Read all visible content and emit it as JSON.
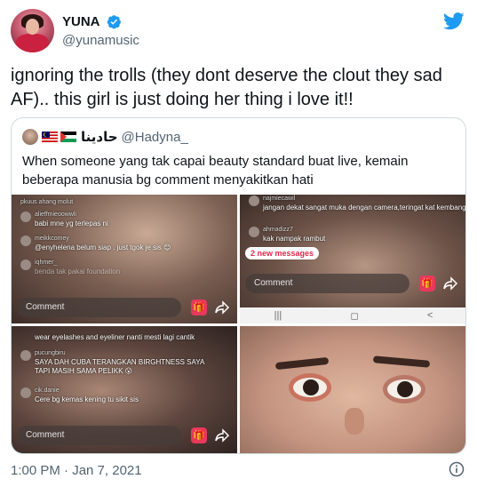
{
  "author": {
    "name": "YUNA",
    "handle": "@yunamusic",
    "verified": true
  },
  "tweet": {
    "text": "ignoring the trolls (they dont deserve the clout they sad AF).. this girl is just doing her thing i love it!!"
  },
  "quoted": {
    "name": "حادينا",
    "handle": "@Hadyna_",
    "text": "When someone yang tak capai beauty standard buat live, kemain beberapa manusia bg comment menyakitkan hati",
    "images": [
      {
        "comments": [
          {
            "user": "pkuus ahang molut",
            "text": ""
          },
          {
            "user": "alieffmieoowwli",
            "text": "babi mne yg terlepas ni"
          },
          {
            "user": "meikkcomey",
            "text": "@enyhelena belum siap . just tgok je sis 😊"
          },
          {
            "user": "iqhmer_",
            "text": "benda tak pakai foundation"
          }
        ],
        "input_placeholder": "Comment"
      },
      {
        "comments": [
          {
            "user": "najmiecawil",
            "text": "jangan dekat sangat muka dengan camera,teringat kat kembang"
          },
          {
            "user": "ahmadizz7",
            "text": "kak nampak rambut"
          }
        ],
        "new_messages": "2 new messages",
        "input_placeholder": "Comment",
        "nav_buttons": [
          "|||",
          "◻",
          "<"
        ]
      },
      {
        "comments": [
          {
            "user": "",
            "text": "wear eyelashes and eyeliner nanti mesti lagi cantik"
          },
          {
            "user": "pucungbiru",
            "text": "SAYA DAH CUBA TERANGKAN BIRGHTNESS SAYA TAPI MASIH SAMA PELIKK 😮"
          },
          {
            "user": "cik.danie",
            "text": "Cere bg kemas kening tu sikit sis"
          }
        ],
        "input_placeholder": "Comment"
      },
      {
        "description_visible": false
      }
    ]
  },
  "footer": {
    "timestamp": "1:00 PM · Jan 7, 2021"
  },
  "colors": {
    "twitter_blue": "#1d9bf0",
    "text_secondary": "#536471",
    "border": "#cfd9de",
    "gift_pink": "#e6395c"
  },
  "icons": [
    "verified-badge-icon",
    "twitter-bird-icon",
    "gift-icon",
    "share-icon",
    "info-icon"
  ]
}
